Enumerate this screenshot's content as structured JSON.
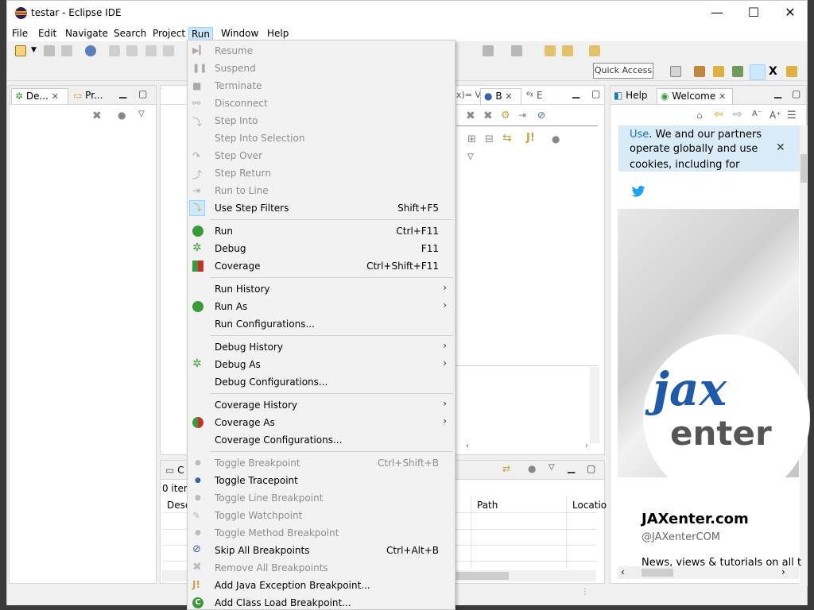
{
  "window": {
    "title": "testar - Eclipse IDE",
    "min_glyph": "—",
    "max_glyph": "☐",
    "close_glyph": "✕"
  },
  "menubar": {
    "items": [
      "File",
      "Edit",
      "Navigate",
      "Search",
      "Project",
      "Run",
      "Window",
      "Help"
    ],
    "active": "Run"
  },
  "toolbar": {
    "quick_access": "Quick Access"
  },
  "left_panel": {
    "tab1": "De...",
    "tab2": "Pr..."
  },
  "center_panel": {
    "tab1": "x)= V",
    "tab2": "B",
    "tab3": "E"
  },
  "bottom_panel": {
    "tab": "C",
    "items_label": "0 item",
    "columns": [
      "Desc",
      "Path",
      "Locatio"
    ]
  },
  "help_panel": {
    "tab_help": "Help",
    "tab_welcome": "Welcome",
    "cookie_link": "Use",
    "cookie_text_1": ". We and our partners",
    "cookie_text_2": "operate globally and use",
    "cookie_text_3": "cookies, including for",
    "logo_line1": "jax",
    "logo_line2": "enter",
    "site_title": "JAXenter.com",
    "handle": "@JAXenterCOM",
    "news": "News, views & tutorials on all t"
  },
  "run_menu": {
    "resume": "Resume",
    "suspend": "Suspend",
    "terminate": "Terminate",
    "disconnect": "Disconnect",
    "step_into": "Step Into",
    "step_into_selection": "Step Into Selection",
    "step_over": "Step Over",
    "step_return": "Step Return",
    "run_to_line": "Run to Line",
    "use_step_filters": "Use Step Filters",
    "use_step_filters_sc": "Shift+F5",
    "run": "Run",
    "run_sc": "Ctrl+F11",
    "debug": "Debug",
    "debug_sc": "F11",
    "coverage": "Coverage",
    "coverage_sc": "Ctrl+Shift+F11",
    "run_history": "Run History",
    "run_as": "Run As",
    "run_configurations": "Run Configurations...",
    "debug_history": "Debug History",
    "debug_as": "Debug As",
    "debug_configurations": "Debug Configurations...",
    "coverage_history": "Coverage History",
    "coverage_as": "Coverage As",
    "coverage_configurations": "Coverage Configurations...",
    "toggle_breakpoint": "Toggle Breakpoint",
    "toggle_breakpoint_sc": "Ctrl+Shift+B",
    "toggle_tracepoint": "Toggle Tracepoint",
    "toggle_line_breakpoint": "Toggle Line Breakpoint",
    "toggle_watchpoint": "Toggle Watchpoint",
    "toggle_method_breakpoint": "Toggle Method Breakpoint",
    "skip_all_breakpoints": "Skip All Breakpoints",
    "skip_all_breakpoints_sc": "Ctrl+Alt+B",
    "remove_all_breakpoints": "Remove All Breakpoints",
    "add_java_exception_breakpoint": "Add Java Exception Breakpoint...",
    "add_class_load_breakpoint": "Add Class Load Breakpoint...",
    "submenu_arrow": "›"
  },
  "colors": {
    "accent": "#1a75bb",
    "menu_active_bg": "#cce8ff",
    "debug_green": "#3a9b3a"
  }
}
